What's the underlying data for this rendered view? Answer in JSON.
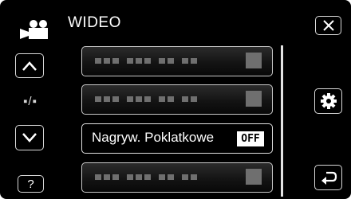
{
  "header": {
    "title": "WIDEO",
    "mode_icon": "video-camera-icon",
    "close_icon": "close-icon"
  },
  "left_nav": {
    "up_icon": "chevron-up-icon",
    "toggle_text": "▪/▪",
    "down_icon": "chevron-down-icon",
    "help_label": "?"
  },
  "menu": {
    "items": [
      {
        "label": "",
        "value": "",
        "greyed": true,
        "selected": false
      },
      {
        "label": "",
        "value": "",
        "greyed": true,
        "selected": false
      },
      {
        "label": "Nagryw. Poklatkowe",
        "value": "OFF",
        "greyed": false,
        "selected": true
      },
      {
        "label": "",
        "value": "",
        "greyed": true,
        "selected": false
      }
    ]
  },
  "right_nav": {
    "settings_icon": "gear-icon",
    "back_icon": "return-arrow-icon"
  },
  "colors": {
    "background": "#000000",
    "border": "#d8d8d8",
    "placeholder": "#6f6f6f",
    "text": "#ffffff"
  }
}
